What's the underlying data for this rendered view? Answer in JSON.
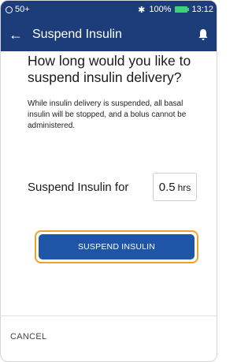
{
  "status_bar": {
    "left_text": "50+",
    "right_text": "100%",
    "time": "13:12",
    "bluetooth_glyph": "✱",
    "icons": [
      "status-circle-icon",
      "bluetooth-icon",
      "battery-icon"
    ]
  },
  "title_bar": {
    "back_glyph": "←",
    "title": "Suspend Insulin",
    "icons": [
      "back-arrow-icon",
      "bell-icon"
    ]
  },
  "main": {
    "heading": "How long would you like to suspend insulin delivery?",
    "description": "While insulin delivery is suspended, all basal insulin will be stopped, and a bolus cannot be administered.",
    "suspend_label": "Suspend Insulin for",
    "duration_value": "0.5",
    "duration_unit": "hrs",
    "suspend_button": "SUSPEND INSULIN"
  },
  "footer": {
    "cancel_label": "CANCEL"
  },
  "colors": {
    "header_bg": "#1d3d7a",
    "button_bg": "#1f55a7",
    "focus_outline": "#f0a22c",
    "battery": "#3fd07a"
  }
}
